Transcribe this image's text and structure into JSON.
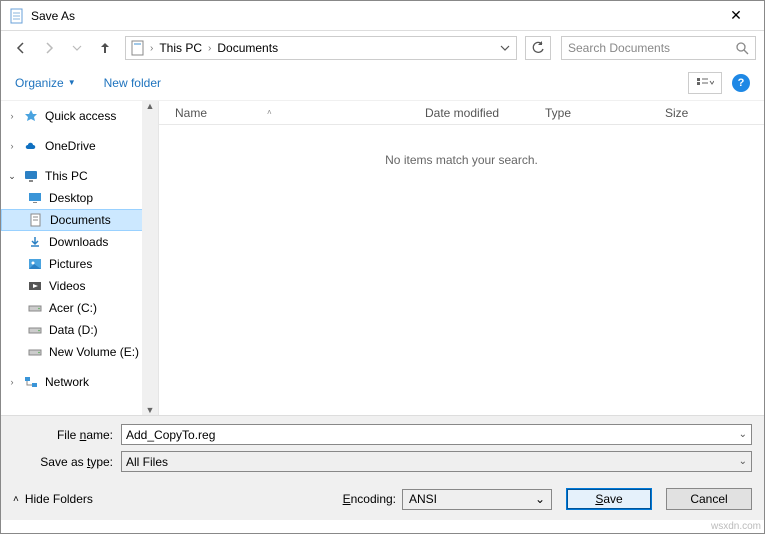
{
  "window": {
    "title": "Save As"
  },
  "breadcrumb": {
    "item1": "This PC",
    "item2": "Documents"
  },
  "search": {
    "placeholder": "Search Documents"
  },
  "toolbar": {
    "organize": "Organize",
    "newfolder": "New folder"
  },
  "sidebar": {
    "quick": "Quick access",
    "onedrive": "OneDrive",
    "thispc": "This PC",
    "desktop": "Desktop",
    "documents": "Documents",
    "downloads": "Downloads",
    "pictures": "Pictures",
    "videos": "Videos",
    "acer": "Acer (C:)",
    "data": "Data (D:)",
    "newvol": "New Volume (E:)",
    "network": "Network"
  },
  "columns": {
    "name": "Name",
    "date": "Date modified",
    "type": "Type",
    "size": "Size"
  },
  "pane": {
    "empty": "No items match your search."
  },
  "footer": {
    "filename_lbl_pre": "File ",
    "filename_lbl_u": "n",
    "filename_lbl_post": "ame:",
    "filename_val": "Add_CopyTo.reg",
    "savetype_lbl_pre": "Save as ",
    "savetype_lbl_u": "t",
    "savetype_lbl_post": "ype:",
    "savetype_val": "All Files",
    "hide": "Hide Folders",
    "encoding_lbl_u": "E",
    "encoding_lbl_post": "ncoding:",
    "encoding_val": "ANSI",
    "save_u": "S",
    "save_post": "ave",
    "cancel": "Cancel"
  },
  "watermark": "wsxdn.com"
}
